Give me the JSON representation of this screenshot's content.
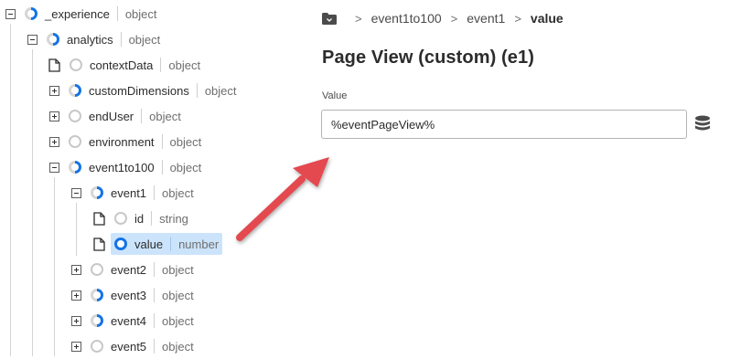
{
  "tree": {
    "nodes": [
      {
        "name": "_experience",
        "type": "object"
      },
      {
        "name": "analytics",
        "type": "object"
      },
      {
        "name": "contextData",
        "type": "object"
      },
      {
        "name": "customDimensions",
        "type": "object"
      },
      {
        "name": "endUser",
        "type": "object"
      },
      {
        "name": "environment",
        "type": "object"
      },
      {
        "name": "event1to100",
        "type": "object"
      },
      {
        "name": "event1",
        "type": "object"
      },
      {
        "name": "id",
        "type": "string"
      },
      {
        "name": "value",
        "type": "number"
      },
      {
        "name": "event2",
        "type": "object"
      },
      {
        "name": "event3",
        "type": "object"
      },
      {
        "name": "event4",
        "type": "object"
      },
      {
        "name": "event5",
        "type": "object"
      }
    ]
  },
  "breadcrumb": {
    "items": [
      "event1to100",
      "event1",
      "value"
    ],
    "folder_icon": "folder-icon"
  },
  "panel": {
    "title": "Page View (custom) (e1)",
    "field_label": "Value",
    "field_value": "%eventPageView%",
    "data_element_icon": "database-icon"
  },
  "colors": {
    "accent": "#1473e6",
    "selection": "#cce4fb",
    "arrow": "#e34850"
  }
}
